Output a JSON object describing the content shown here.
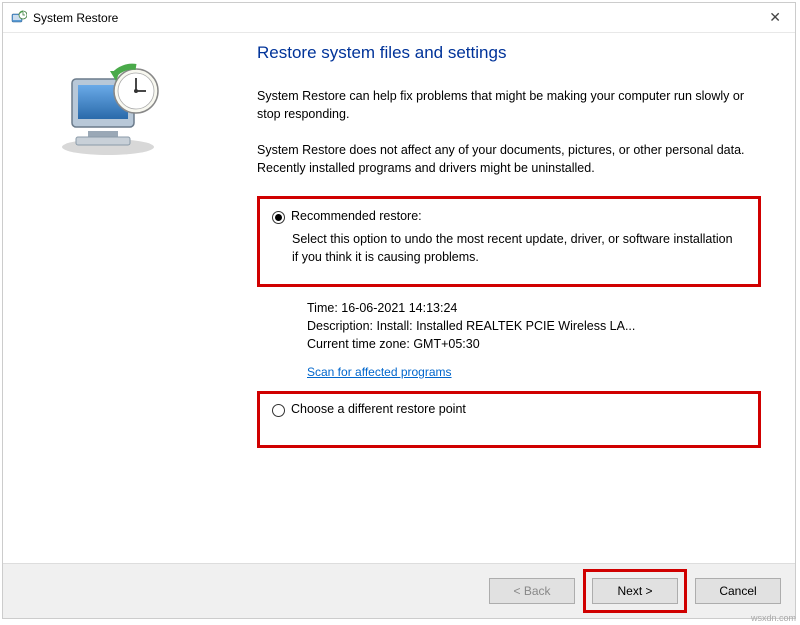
{
  "titlebar": {
    "title": "System Restore"
  },
  "heading": "Restore system files and settings",
  "intro1": "System Restore can help fix problems that might be making your computer run slowly or stop responding.",
  "intro2": "System Restore does not affect any of your documents, pictures, or other personal data. Recently installed programs and drivers might be uninstalled.",
  "option_recommended": {
    "label": "Recommended restore:",
    "desc": "Select this option to undo the most recent update, driver, or software installation if you think it is causing problems."
  },
  "details": {
    "time_label": "Time:",
    "time_value": "16-06-2021 14:13:24",
    "desc_label": "Description:",
    "desc_value": "Install: Installed REALTEK PCIE Wireless LA...",
    "tz_label": "Current time zone:",
    "tz_value": "GMT+05:30",
    "scan_link": "Scan for affected programs"
  },
  "option_different": {
    "label": "Choose a different restore point"
  },
  "buttons": {
    "back": "< Back",
    "next": "Next >",
    "cancel": "Cancel"
  },
  "watermark": "wsxdn.com"
}
